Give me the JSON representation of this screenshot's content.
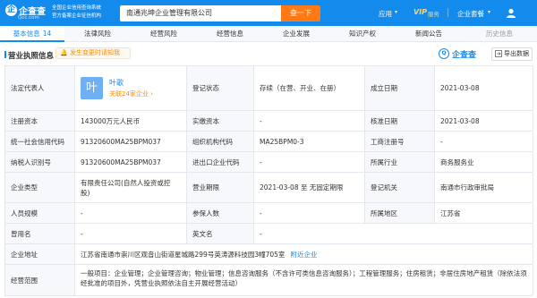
{
  "header": {
    "logo_mark": "企",
    "logo_name": "企查查",
    "logo_domain": "Qcc.com",
    "tagline": [
      "全国企业信用查询系统",
      "官方备案企业征信机构"
    ],
    "search_value": "南通兆坤企业管理有限公司",
    "search_button": "查一下",
    "nav": {
      "app": "应用",
      "vip": "VIP",
      "vip_sub": "服务",
      "package": "企业套餐"
    }
  },
  "tabs": [
    {
      "label": "基本信息",
      "count": "14"
    },
    {
      "label": "法律风险"
    },
    {
      "label": "经营风险"
    },
    {
      "label": "经营信息"
    },
    {
      "label": "企业发展"
    },
    {
      "label": "知识产权"
    },
    {
      "label": "新闻公告"
    },
    {
      "label": "历史信息"
    }
  ],
  "section": {
    "title": "营业执照信息",
    "notice": "发生变更时请知我",
    "watermark": "企查查",
    "watermark_mark": "Q",
    "export": "导出数据"
  },
  "info": {
    "rep_label": "法定代表人",
    "avatar": "叶",
    "rep_name": "叶歌",
    "rep_assoc": "关联24家企业 ›",
    "status_label": "登记状态",
    "status_value": "存续（在营、开业、在册）",
    "founded_label": "成立日期",
    "founded_value": "2021-03-08",
    "capital_label": "注册资本",
    "capital_value": "143000万元人民币",
    "paid_label": "实缴资本",
    "paid_value": "-",
    "approved_label": "核准日期",
    "approved_value": "2021-03-08",
    "uscc_label": "统一社会信用代码",
    "uscc_value": "91320600MA25BPM037",
    "org_label": "组织机构代码",
    "org_value": "MA25BPM0-3",
    "reg_no_label": "工商注册号",
    "reg_no_value": "-",
    "tax_label": "纳税人识别号",
    "tax_value": "91320600MA25BPM037",
    "ie_label": "进出口企业代码",
    "ie_value": "-",
    "industry_label": "所属行业",
    "industry_value": "商务服务业",
    "type_label": "企业类型",
    "type_value_1": "有限责任公司(自然人投资或控",
    "type_value_2": "股)",
    "term_label": "营业期限",
    "term_value": "2021-03-08 至 无固定期限",
    "authority_label": "登记机关",
    "authority_value": "南通市行政审批局",
    "staff_label": "人员规模",
    "staff_value": "-",
    "insured_label": "参保人数",
    "insured_value": "-",
    "region_label": "所属地区",
    "region_value": "江苏省",
    "former_label": "曾用名",
    "former_value": "-",
    "english_label": "英文名",
    "english_value": "-",
    "address_label": "企业地址",
    "address_value": "江苏省南通市崇川区观音山街道星城路299号英涛源科技园3幢705室",
    "address_link": "附近企业",
    "scope_label": "经营范围",
    "scope_value": "一般项目：企业管理；企业管理咨询；物业管理；信息咨询服务（不含许可类信息咨询服务）；工程管理服务；住房租赁；非居住房地产租赁（除依法须经批准的项目外，凭营业执照依法自主开展经营活动）"
  },
  "colors": {
    "brand": "#128bed",
    "accent": "#ff7a17",
    "warning": "#ff8a00"
  }
}
